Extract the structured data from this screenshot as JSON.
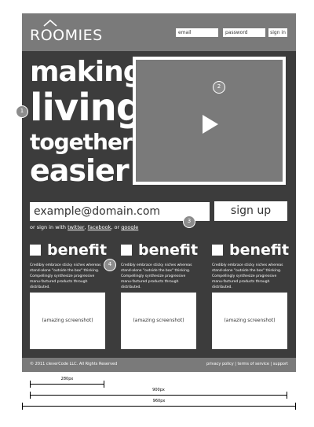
{
  "brand": {
    "logo": "ROOMIES"
  },
  "header": {
    "email_placeholder": "email",
    "password_placeholder": "password",
    "signin_label": "sign in"
  },
  "hero": {
    "line1": "making",
    "line2": "living",
    "line3": "together",
    "line4": "easier"
  },
  "annotations": {
    "a1": "1",
    "a2": "2",
    "a3": "3",
    "a4": "4"
  },
  "signup": {
    "email_value": "example@domain.com",
    "button_label": "sign up",
    "alt_prefix": "or sign in with",
    "twitter": "twitter",
    "facebook": "facebook",
    "google": "google",
    "sep1": ",",
    "sep2": ", or"
  },
  "benefits": [
    {
      "title": "benefit",
      "desc": "Credibly embrace sticky niches whereas stand-alone \"outside the box\" thinking. Compellingly synthesize progressive manu-factured products through distributed.",
      "shot": "(amazing screenshot)"
    },
    {
      "title": "benefit",
      "desc": "Credibly embrace sticky niches whereas stand-alone \"outside the box\" thinking. Compellingly synthesize progressive manu-factured products through distributed.",
      "shot": "(amazing screenshot)"
    },
    {
      "title": "benefit",
      "desc": "Credibly embrace sticky niches whereas stand-alone \"outside the box\" thinking. Compellingly synthesize progressive manu-factured products through distributed.",
      "shot": "(amazing screenshot)"
    }
  ],
  "footer": {
    "copyright": "© 2011 cleverCode LLC. All Rights Reserved",
    "links": "privacy policy | terms of service | support"
  },
  "dimensions": {
    "d1": "280px",
    "d2": "900px",
    "d3": "960px"
  },
  "colors": {
    "frame": "#3c3c3c",
    "bars": "#7a7a7a",
    "text": "#ffffff"
  }
}
